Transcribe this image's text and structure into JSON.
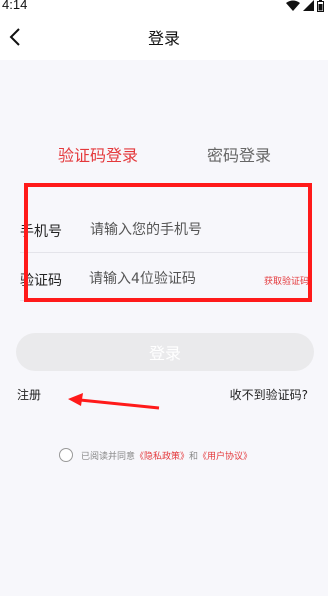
{
  "status_bar": {
    "time": "4:14"
  },
  "nav": {
    "title": "登录"
  },
  "tabs": [
    {
      "label": "验证码登录",
      "active": true
    },
    {
      "label": "密码登录",
      "active": false
    }
  ],
  "form": {
    "phone_label": "手机号",
    "phone_placeholder": "请输入您的手机号",
    "code_label": "验证码",
    "code_placeholder": "请输入4位验证码",
    "get_code_label": "获取验证码"
  },
  "login_button": "登录",
  "links": {
    "register": "注册",
    "no_code": "收不到验证码?"
  },
  "agreement": {
    "prefix": "已阅读并同意",
    "privacy": "《隐私政策》",
    "and": "和",
    "user_agreement": "《用户协议》"
  },
  "colors": {
    "accent": "#e4393c",
    "annotation": "#ff1a1a"
  }
}
